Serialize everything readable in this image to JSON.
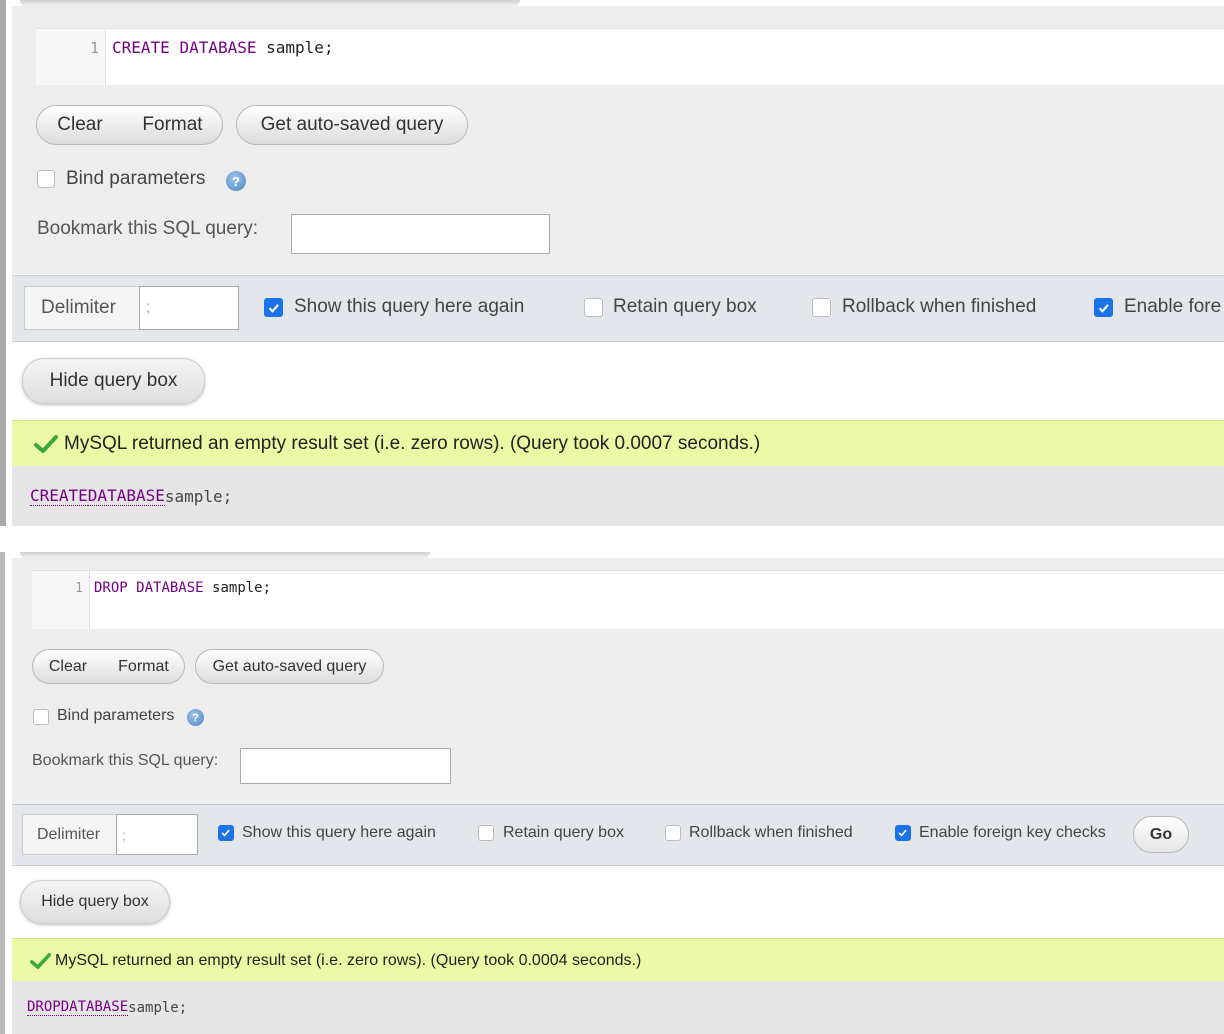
{
  "panels": [
    {
      "line_number": "1",
      "code": {
        "kw1": "CREATE",
        "kw2": "DATABASE",
        "rest": "sample;"
      },
      "buttons": {
        "clear": "Clear",
        "format": "Format",
        "autosaved": "Get auto-saved query"
      },
      "bind_parameters": "Bind parameters",
      "help_icon": "?",
      "bookmark_label": "Bookmark this SQL query:",
      "bookmark_value": "",
      "delimiter_label": "Delimiter",
      "delimiter_value": ";",
      "options": {
        "show_query": "Show this query here again",
        "retain": "Retain query box",
        "rollback": "Rollback when finished",
        "foreign": "Enable fore"
      },
      "hide_button": "Hide query box",
      "success_message": "MySQL returned an empty result set (i.e. zero rows). (Query took 0.0007 seconds.)",
      "sql_echo": {
        "kw1": "CREATE",
        "kw2": "DATABASE",
        "rest": "sample;"
      }
    },
    {
      "line_number": "1",
      "code": {
        "kw1": "DROP",
        "kw2": "DATABASE",
        "rest": "sample;"
      },
      "buttons": {
        "clear": "Clear",
        "format": "Format",
        "autosaved": "Get auto-saved query"
      },
      "bind_parameters": "Bind parameters",
      "help_icon": "?",
      "bookmark_label": "Bookmark this SQL query:",
      "bookmark_value": "",
      "delimiter_label": "Delimiter",
      "delimiter_value": ";",
      "options": {
        "show_query": "Show this query here again",
        "retain": "Retain query box",
        "rollback": "Rollback when finished",
        "foreign": "Enable foreign key checks"
      },
      "go_button": "Go",
      "hide_button": "Hide query box",
      "success_message": "MySQL returned an empty result set (i.e. zero rows). (Query took 0.0004 seconds.)",
      "sql_echo": {
        "kw1": "DROP",
        "kw2": "DATABASE",
        "rest": "sample;"
      }
    }
  ],
  "colors": {
    "keyword": "#770088",
    "checkbox_on": "#1a73e8",
    "success_bg": "#ebf8a4",
    "check_icon": "#3aa83a"
  }
}
